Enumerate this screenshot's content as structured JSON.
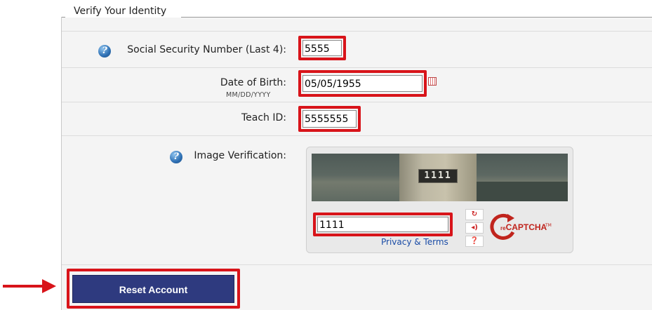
{
  "fieldset": {
    "legend": "Verify Your Identity"
  },
  "ssn": {
    "label": "Social Security Number (Last 4):",
    "value": "5555"
  },
  "dob": {
    "label": "Date of Birth:",
    "format_hint": "MM/DD/YYYY",
    "value": "05/05/1955"
  },
  "teach_id": {
    "label": "Teach ID:",
    "value": "5555555"
  },
  "captcha": {
    "label": "Image Verification:",
    "image_text": "1111",
    "response_value": "1111",
    "privacy_link": "Privacy & Terms",
    "brand": "reCAPTCHA",
    "brand_prefix": "re",
    "brand_main": "CAPTCHA",
    "trademark": "TM"
  },
  "submit": {
    "label": "Reset Account"
  },
  "colors": {
    "highlight": "#d8141a",
    "button": "#2e3a7f",
    "link": "#1a4ca6"
  },
  "icons": [
    "help-icon",
    "calendar-icon",
    "refresh-icon",
    "audio-icon",
    "captcha-help-icon",
    "arrow-icon"
  ]
}
